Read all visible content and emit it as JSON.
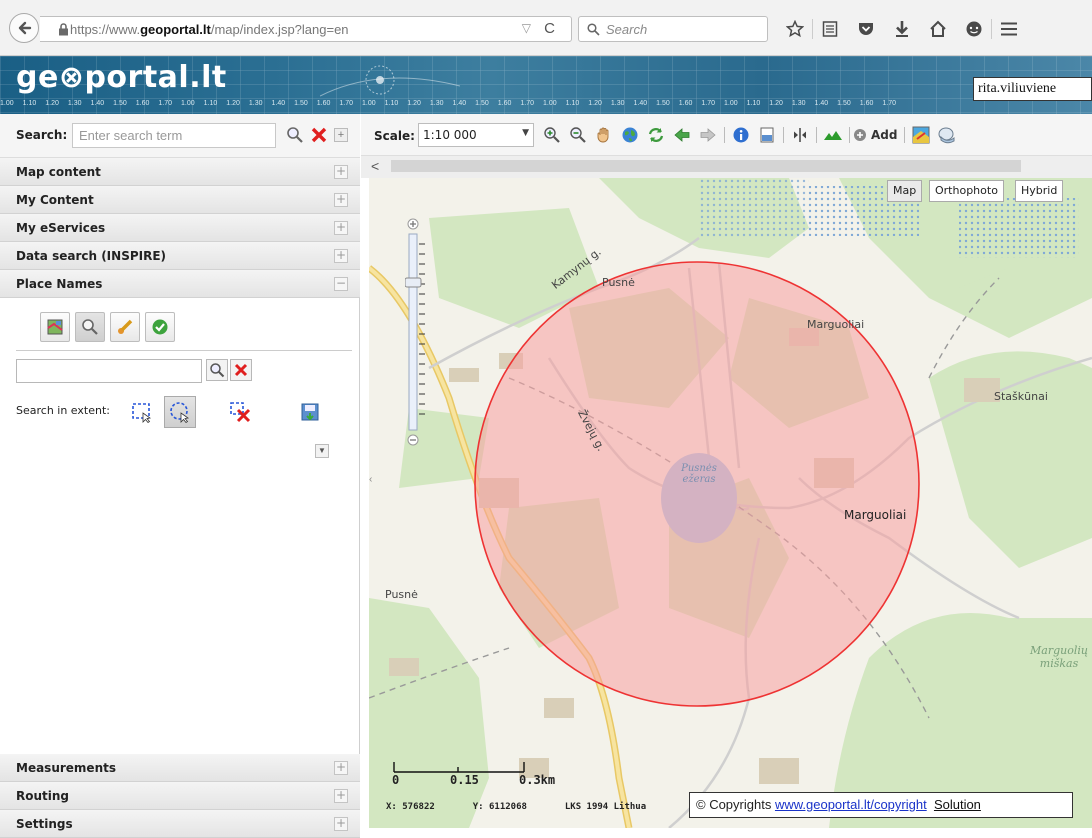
{
  "browser": {
    "url_prefix": "https://www.",
    "url_domain": "geoportal.lt",
    "url_path": "/map/index.jsp?lang=en",
    "search_placeholder": "Search"
  },
  "banner": {
    "logo": "ge⊗portal.lt",
    "scale_ticks": [
      "1.00",
      "1.10",
      "1.20",
      "1.30",
      "1.40",
      "1.50",
      "1.60",
      "1.70",
      "1.00",
      "1.10",
      "1.20",
      "1.30",
      "1.40",
      "1.50",
      "1.60",
      "1.70",
      "1.00",
      "1.10",
      "1.20",
      "1.30",
      "1.40",
      "1.50",
      "1.60",
      "1.70",
      "1.00",
      "1.10",
      "1.20",
      "1.30",
      "1.40",
      "1.50",
      "1.60",
      "1.70",
      "1.00",
      "1.10",
      "1.20",
      "1.30",
      "1.40",
      "1.50",
      "1.60",
      "1.70"
    ],
    "user": "rita.viliuviene"
  },
  "left": {
    "search_label": "Search:",
    "search_placeholder": "Enter search term",
    "sections": [
      "Map content",
      "My Content",
      "My eServices",
      "Data search (INSPIRE)",
      "Place Names"
    ],
    "bottom_sections": [
      "Measurements",
      "Routing",
      "Settings"
    ],
    "place_names": {
      "search_in_extent": "Search in extent:"
    }
  },
  "map_toolbar": {
    "scale_label": "Scale:",
    "scale_value": "1:10 000",
    "add_label": "Add"
  },
  "map": {
    "types": [
      "Map",
      "Orthophoto",
      "Hybrid"
    ],
    "selected_type": "Map",
    "labels": {
      "kamynu": "Kamynų g.",
      "pusne_top": "Pusnė",
      "marguoliai_top": "Marguoliai",
      "stas": "Staškūnai",
      "zveju": "Žvejų g.",
      "ezeras": "Pusnės ežeras",
      "marguoliai_mid": "Marguoliai",
      "pusne_left": "Pusnė",
      "miskas": "Marguolių miškas"
    },
    "scale": {
      "t0": "0",
      "t1": "0.15",
      "t2": "0.3km"
    },
    "coords": {
      "x_label": "X:",
      "x": "576822",
      "y_label": "Y:",
      "y": "6112068",
      "crs": "LKS 1994 Lithua"
    },
    "copyright_prefix": "© Copyrights ",
    "copyright_link": "www.geoportal.lt/copyright",
    "solution": "Solution"
  },
  "colors": {
    "circle_fill": "#f8a1a1",
    "circle_stroke": "#e33",
    "forest": "#d7e9c4",
    "road": "#f2d583"
  }
}
